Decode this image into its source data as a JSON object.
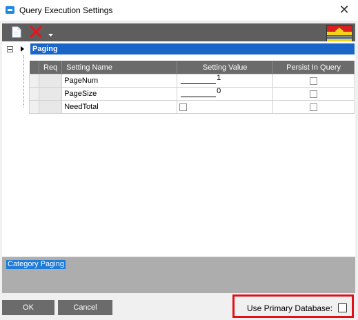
{
  "window": {
    "title": "Query Execution Settings",
    "close_glyph": "✕"
  },
  "toolbar": {
    "new_icon": "new-document-icon",
    "delete_icon": "delete-x-icon",
    "dropdown_icon": "dropdown-arrow-icon",
    "flag_icon": "flag-icon"
  },
  "grid": {
    "category_band": "Paging",
    "columns": [
      "Req",
      "Setting Name",
      "Setting Value",
      "Persist In Query"
    ],
    "rows": [
      {
        "name": "PageNum",
        "value": "1",
        "value_type": "text",
        "persist": false
      },
      {
        "name": "PageSize",
        "value": "0",
        "value_type": "text",
        "persist": false
      },
      {
        "name": "NeedTotal",
        "value": "",
        "value_type": "checkbox",
        "persist": false
      }
    ]
  },
  "description": {
    "text": "Category Paging"
  },
  "buttons": {
    "ok": "OK",
    "cancel": "Cancel"
  },
  "primary_db": {
    "label": "Use Primary Database:",
    "checked": false
  },
  "colors": {
    "highlight": "#e0101a",
    "selection": "#1a66c8",
    "header_gray": "#6b6b6b"
  }
}
